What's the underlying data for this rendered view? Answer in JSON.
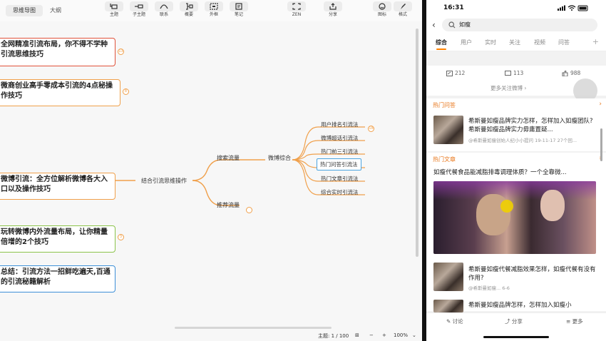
{
  "mindmap": {
    "tabs": {
      "active": "思维导图",
      "outline": "大纲"
    },
    "toolbar": {
      "topic": "主题",
      "subtopic": "子主题",
      "relation": "联系",
      "summary": "概要",
      "boundary": "外框",
      "note": "笔记",
      "zen": "ZEN",
      "share": "分享",
      "icon": "图标",
      "format": "格式"
    },
    "nodes": {
      "n1": "全网精准引流布局，你不得不学种引流思维技巧",
      "n2": "微商创业高手零成本引流的4点秘操作技巧",
      "n3": "微博引流：全方位解析微博各大入口以及操作技巧",
      "n4": "玩转微博内外流量布局，让你精量倍增的2个技巧",
      "n5": "总结：引流方法一招鲜吃遍天,百通的引流秘籍解析"
    },
    "branch": {
      "main": "结合引流思维操作",
      "search": "搜索流量",
      "recommend": "推荐流量",
      "weibo": "微博综合"
    },
    "leaves": [
      "用户排名引流法",
      "微博超话引流法",
      "热门前三引流法",
      "热门问答引流法",
      "热门文章引流法",
      "综合实时引流法"
    ],
    "badges": {
      "b1": "13",
      "b2": "8",
      "b3": "3",
      "b4": "18"
    },
    "status": {
      "topics": "主题: 1 / 100",
      "zoom_minus": "−",
      "zoom_plus": "+",
      "zoom": "100%"
    }
  },
  "phone": {
    "time": "16:31",
    "search_query": "如瘦",
    "tabs": [
      "综合",
      "用户",
      "实时",
      "关注",
      "视频",
      "问答"
    ],
    "stats": {
      "repost": "212",
      "comment": "113",
      "like": "988"
    },
    "more_follow": "更多关注微博 ›",
    "hot_qa": {
      "title": "热门问答",
      "item_title": "希斯曼如瘦品牌实力怎样，怎样加入如瘦团队?希斯曼如瘦品牌实力毋庸置疑...",
      "item_meta": "@希斯曼如瘦创始人纪小小提问 19-11-17  27个回..."
    },
    "hot_article": {
      "title": "热门文章",
      "headline": "如瘦代餐食品能减脂排毒调理体质？一个全靠微...",
      "item2_title": "希斯曼如瘦代餐减脂效果怎样，如瘦代餐有没有作用?",
      "item2_meta": "@希斯曼如瘦...  6-6",
      "item3_title": "希斯曼如瘦品牌怎样，怎样加入如瘦小"
    },
    "bottom": {
      "discuss": "讨论",
      "share": "分享",
      "more": "更多"
    }
  },
  "colors": {
    "red_border": "#e0523a",
    "orange_border": "#f0a04b",
    "green_border": "#8bc34a",
    "blue_border": "#3d8fd8",
    "weibo_orange": "#ff8200"
  }
}
